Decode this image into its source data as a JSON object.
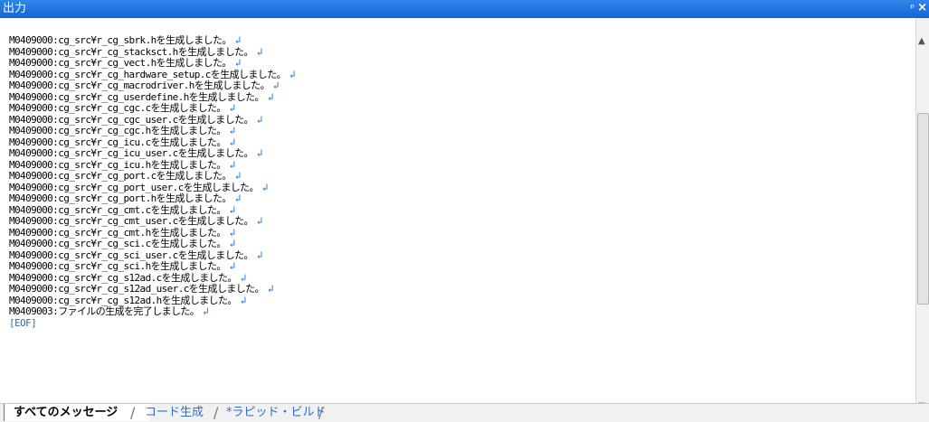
{
  "window": {
    "title": "出力",
    "pin_glyph": "ᵖ",
    "close_glyph": "×"
  },
  "output": {
    "lines": [
      "M0409000:cg_src¥r_cg_sbrk.hを生成しました。",
      "M0409000:cg_src¥r_cg_stacksct.hを生成しました。",
      "M0409000:cg_src¥r_cg_vect.hを生成しました。",
      "M0409000:cg_src¥r_cg_hardware_setup.cを生成しました。",
      "M0409000:cg_src¥r_cg_macrodriver.hを生成しました。",
      "M0409000:cg_src¥r_cg_userdefine.hを生成しました。",
      "M0409000:cg_src¥r_cg_cgc.cを生成しました。",
      "M0409000:cg_src¥r_cg_cgc_user.cを生成しました。",
      "M0409000:cg_src¥r_cg_cgc.hを生成しました。",
      "M0409000:cg_src¥r_cg_icu.cを生成しました。",
      "M0409000:cg_src¥r_cg_icu_user.cを生成しました。",
      "M0409000:cg_src¥r_cg_icu.hを生成しました。",
      "M0409000:cg_src¥r_cg_port.cを生成しました。",
      "M0409000:cg_src¥r_cg_port_user.cを生成しました。",
      "M0409000:cg_src¥r_cg_port.hを生成しました。",
      "M0409000:cg_src¥r_cg_cmt.cを生成しました。",
      "M0409000:cg_src¥r_cg_cmt_user.cを生成しました。",
      "M0409000:cg_src¥r_cg_cmt.hを生成しました。",
      "M0409000:cg_src¥r_cg_sci.cを生成しました。",
      "M0409000:cg_src¥r_cg_sci_user.cを生成しました。",
      "M0409000:cg_src¥r_cg_sci.hを生成しました。",
      "M0409000:cg_src¥r_cg_s12ad.cを生成しました。",
      "M0409000:cg_src¥r_cg_s12ad_user.cを生成しました。",
      "M0409000:cg_src¥r_cg_s12ad.hを生成しました。",
      "M0409003:ファイルの生成を完了しました。"
    ],
    "return_glyph": "↲",
    "eof": "[EOF]"
  },
  "tabs": [
    {
      "label": "すべてのメッセージ",
      "active": true
    },
    {
      "label": "コード生成",
      "active": false
    },
    {
      "label": "*ラピッド・ビルド",
      "active": false
    }
  ],
  "colors": {
    "titlebar": "#1663d6",
    "accent_text": "#1a6fd6"
  }
}
